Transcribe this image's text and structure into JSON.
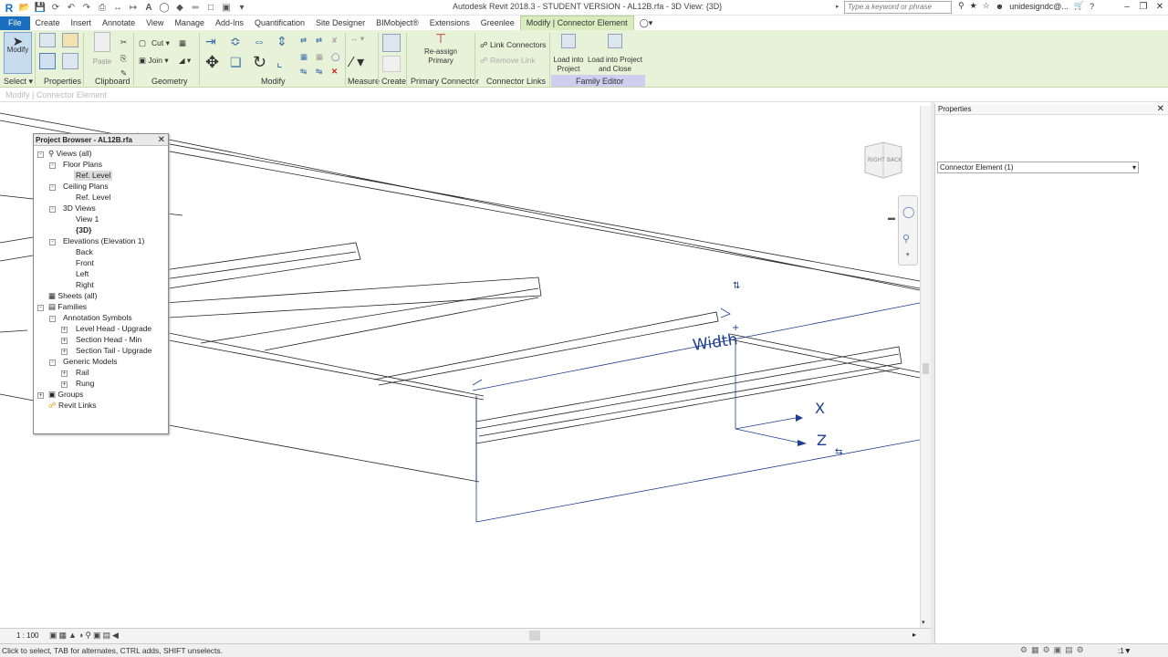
{
  "title_bar": {
    "title": "Autodesk Revit 2018.3 - STUDENT VERSION -    AL12B.rfa - 3D View: {3D}",
    "search_placeholder": "Type a keyword or phrase",
    "user": "unidesigndc@..."
  },
  "tabs": [
    {
      "label": "File"
    },
    {
      "label": "Create"
    },
    {
      "label": "Insert"
    },
    {
      "label": "Annotate"
    },
    {
      "label": "View"
    },
    {
      "label": "Manage"
    },
    {
      "label": "Add-Ins"
    },
    {
      "label": "Quantification"
    },
    {
      "label": "Site Designer"
    },
    {
      "label": "BIMobject®"
    },
    {
      "label": "Extensions"
    },
    {
      "label": "Greenlee"
    },
    {
      "label": "Modify | Connector Element"
    }
  ],
  "ribbon": {
    "modify_label": "Modify",
    "paste_label": "Paste",
    "cut_label": "Cut",
    "join_label": "Join",
    "reassign_label": "Re-assign Primary",
    "link_connectors_label": "Link Connectors",
    "remove_link_label": "Remove Link",
    "load_into_project_label": "Load into Project",
    "load_close_label": "Load into Project and Close",
    "groups": {
      "select": "Select",
      "properties": "Properties",
      "clipboard": "Clipboard",
      "geometry": "Geometry",
      "modify": "Modify",
      "measure": "Measure",
      "create": "Create",
      "primary_connector": "Primary Connector",
      "connector_links": "Connector Links",
      "family_editor": "Family Editor"
    }
  },
  "context_bar": "Modify | Connector Element",
  "project_browser": {
    "title": "Project Browser - AL12B.rfa",
    "items": [
      {
        "label": "Views (all)"
      },
      {
        "label": "Floor Plans"
      },
      {
        "label": "Ref. Level"
      },
      {
        "label": "Ceiling Plans"
      },
      {
        "label": "Ref. Level"
      },
      {
        "label": "3D Views"
      },
      {
        "label": "View 1"
      },
      {
        "label": "{3D}"
      },
      {
        "label": "Elevations (Elevation 1)"
      },
      {
        "label": "Back"
      },
      {
        "label": "Front"
      },
      {
        "label": "Left"
      },
      {
        "label": "Right"
      },
      {
        "label": "Sheets (all)"
      },
      {
        "label": "Families"
      },
      {
        "label": "Annotation Symbols"
      },
      {
        "label": "Level Head - Upgrade"
      },
      {
        "label": "Section Head - Min"
      },
      {
        "label": "Section Tail - Upgrade"
      },
      {
        "label": "Generic Models"
      },
      {
        "label": "Rail"
      },
      {
        "label": "Rung"
      },
      {
        "label": "Groups"
      },
      {
        "label": "Revit Links"
      }
    ]
  },
  "properties": {
    "title": "Properties",
    "selector": "Connector Element (1)"
  },
  "canvas": {
    "width_label": "Width",
    "axis_x": "X",
    "axis_z": "Z",
    "cube_right": "RIGHT",
    "cube_back": "BACK"
  },
  "view_bar": {
    "scale": "1 : 100"
  },
  "status": {
    "message": "Click to select, TAB for alternates, CTRL adds, SHIFT unselects.",
    "selection_count": ":1"
  },
  "colors": {
    "ribbon_bg": "#e8f2d8",
    "file_tab": "#1a6ec0",
    "family_editor": "#cfcdf0",
    "connector_blue": "#1c3e8f"
  }
}
